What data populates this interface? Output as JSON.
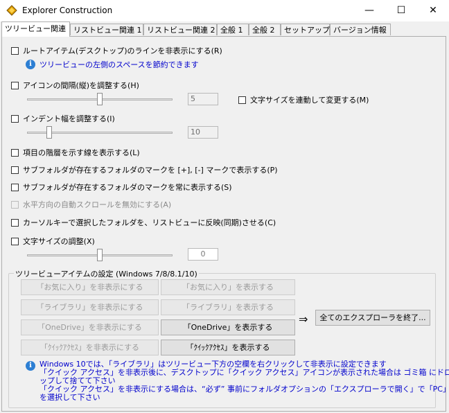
{
  "window": {
    "title": "Explorer Construction",
    "minimize": "—",
    "maximize": "☐",
    "close": "✕"
  },
  "tabs": [
    {
      "label": "ツリービュー関連"
    },
    {
      "label": "リストビュー関連 1"
    },
    {
      "label": "リストビュー関連 2"
    },
    {
      "label": "全般 1"
    },
    {
      "label": "全般 2"
    },
    {
      "label": "セットアップ"
    },
    {
      "label": "バージョン情報"
    }
  ],
  "options": {
    "hide_root_line": "ルートアイテム(デスクトップ)のラインを非表示にする(R)",
    "hide_root_note": "ツリービューの左側のスペースを節約できます",
    "icon_spacing": "アイコンの間隔(縦)を調整する(H)",
    "icon_spacing_value": "5",
    "font_link": "文字サイズを連動して変更する(M)",
    "indent": "インデント幅を調整する(I)",
    "indent_value": "10",
    "hierarchy_lines": "項目の階層を示す線を表示する(L)",
    "folder_marks_pm": "サブフォルダが存在するフォルダのマークを [+], [-] マークで表示する(P)",
    "folder_marks_always": "サブフォルダが存在するフォルダのマークを常に表示する(S)",
    "hscroll_disable": "水平方向の自動スクロールを無効にする(A)",
    "cursor_sync": "カーソルキーで選択したフォルダを、リストビューに反映(同期)させる(C)",
    "font_size": "文字サイズの調整(X)",
    "font_size_value": "0"
  },
  "group": {
    "title": "ツリービューアイテムの設定 (Windows 7/8/8.1/10)",
    "hide_favorites": "「お気に入り」を非表示にする",
    "show_favorites": "「お気に入り」を表示する",
    "hide_libraries": "「ライブラリ」を非表示にする",
    "show_libraries": "「ライブラリ」を表示する",
    "hide_onedrive": "「OneDrive」を非表示にする",
    "show_onedrive": "「OneDrive」を表示する",
    "hide_quick": "「ｸｲｯｸｱｸｾｽ」を非表示にする",
    "show_quick": "「ｸｲｯｸｱｸｾｽ」を表示する",
    "arrow": "⇒",
    "exit_all": "全てのエクスプローラを終了...",
    "note_lines": [
      "Windows 10では、「ライブラリ」はツリービュー下方の空欄を右クリックして非表示に設定できます",
      "「クイック アクセス」を非表示後に、デスクトップに「クイック アクセス」アイコンが表示された場合は ゴミ箱 にドロ",
      "ップして捨てて下さい",
      "「クイック アクセス」を非表示にする場合は、“必ず” 事前にフォルダオプションの「エクスプローラで開く」で「PC」",
      "を選択して下さい"
    ]
  },
  "sliders": {
    "icon_spacing": 0.5,
    "indent": 0.15,
    "font_size": 0.5
  },
  "colors": {
    "accent_blue": "#0000cc",
    "info_icon": "#2d7fd3"
  }
}
